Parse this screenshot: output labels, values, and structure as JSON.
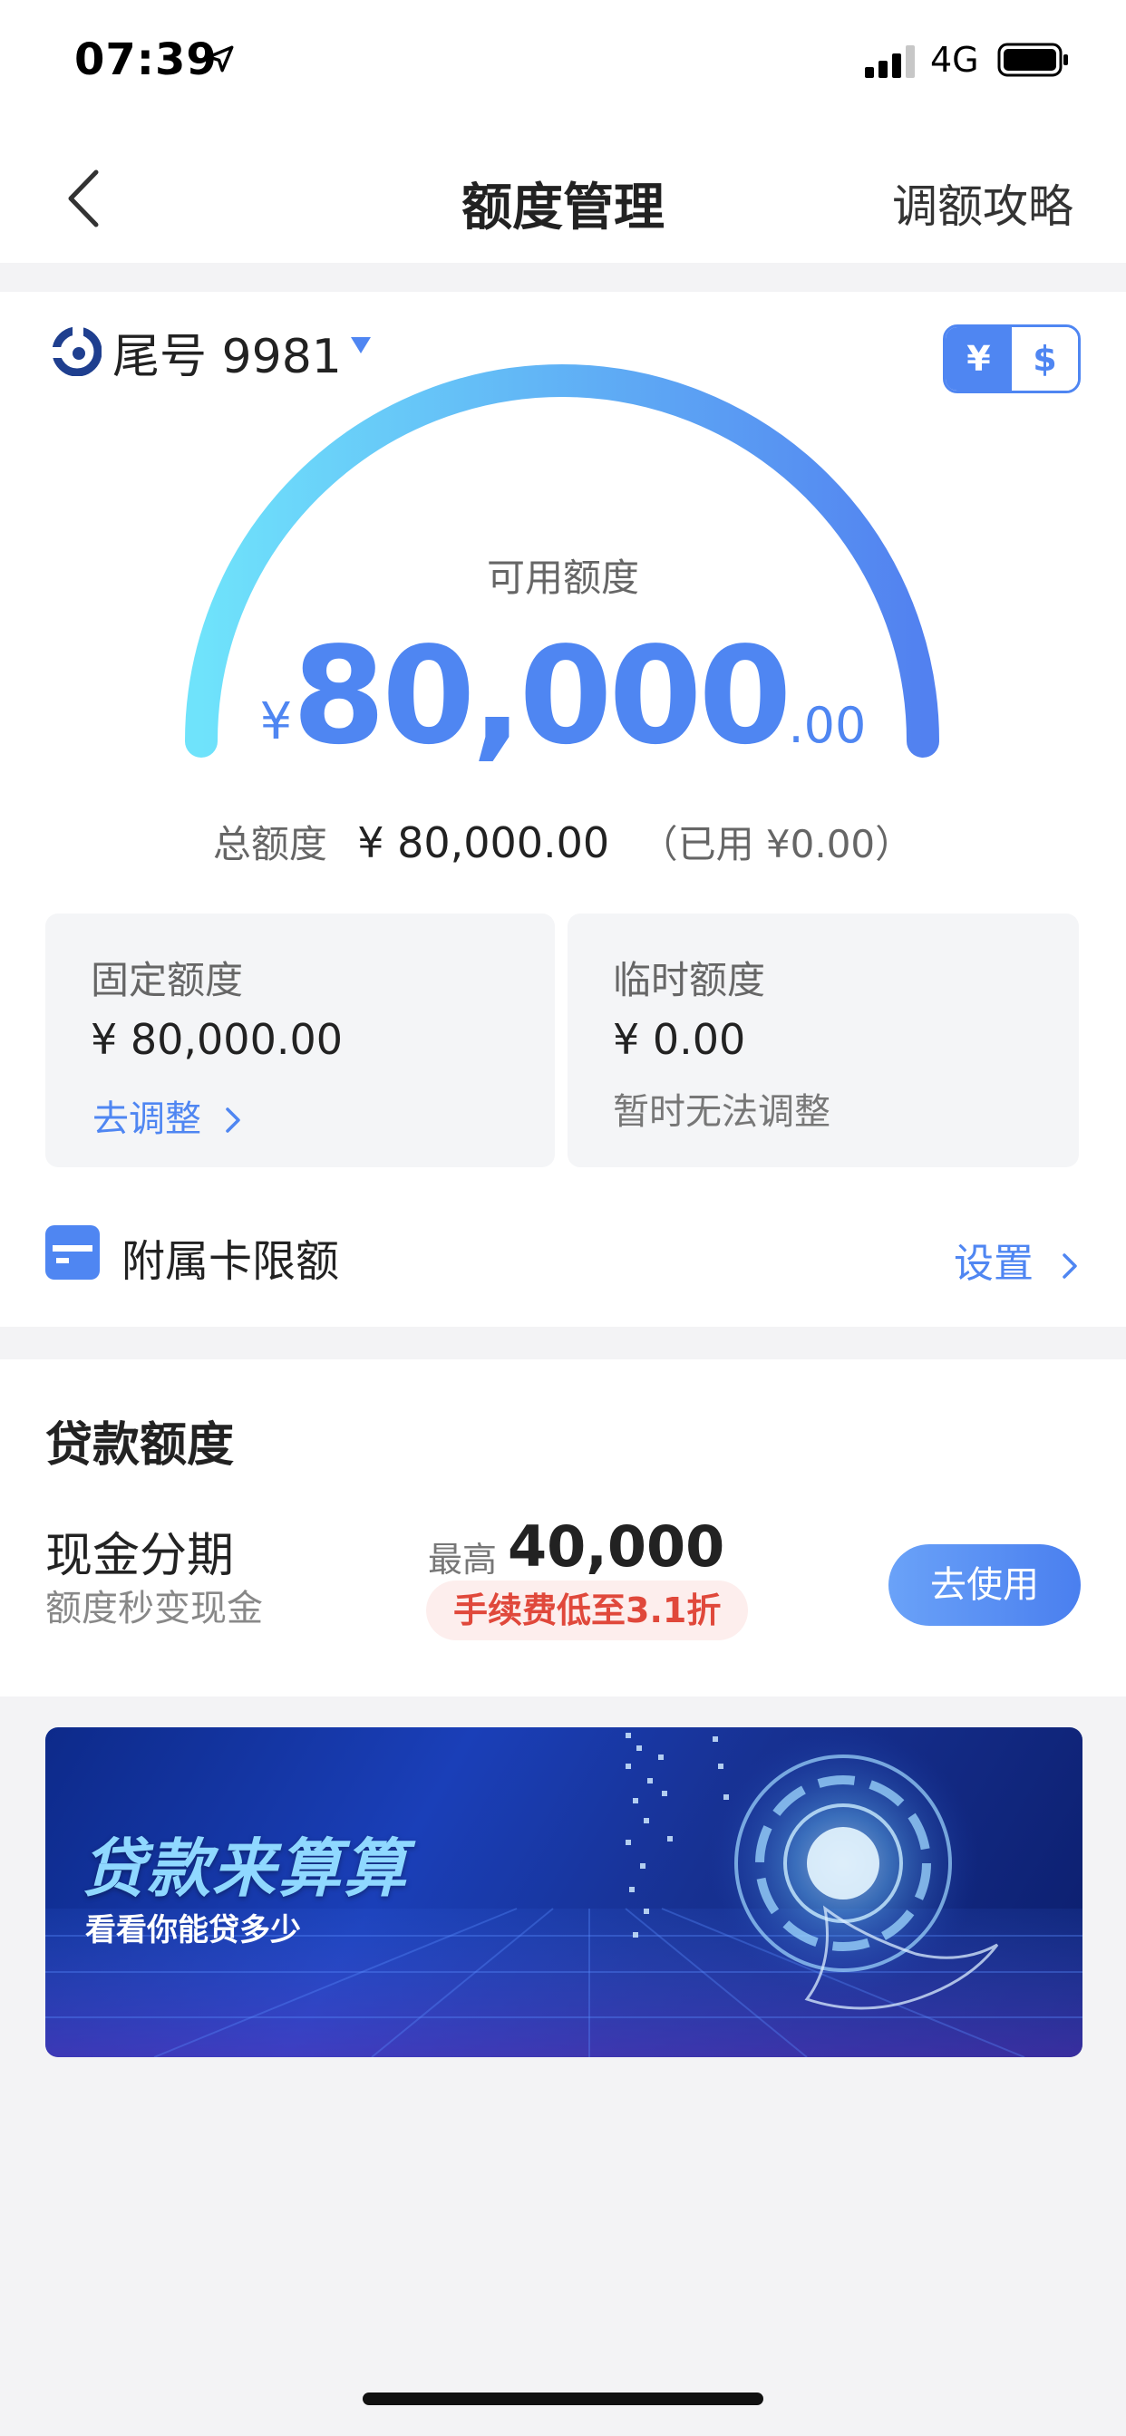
{
  "status_bar": {
    "time": "07:39",
    "network": "4G"
  },
  "nav": {
    "title": "额度管理",
    "right_action": "调额攻略"
  },
  "card": {
    "label": "尾号 9981",
    "currency_options": [
      "¥",
      "$"
    ],
    "selected_currency": "¥"
  },
  "available": {
    "label": "可用额度",
    "symbol": "¥",
    "integer": "80,000",
    "decimal": ".00"
  },
  "totals": {
    "label": "总额度",
    "value": "¥ 80,000.00",
    "used": "（已用 ¥0.00）"
  },
  "fixed_quota": {
    "title": "固定额度",
    "value": "¥ 80,000.00",
    "action": "去调整"
  },
  "temp_quota": {
    "title": "临时额度",
    "value": "¥ 0.00",
    "note": "暂时无法调整"
  },
  "sub_card": {
    "label": "附属卡限额",
    "action": "设置"
  },
  "loan": {
    "section_title": "贷款额度",
    "product_name": "现金分期",
    "product_desc": "额度秒变现金",
    "max_label": "最高",
    "max_value": "40,000",
    "fee_tag": "手续费低至3.1折",
    "button": "去使用"
  },
  "banner": {
    "title": "贷款来算算",
    "subtitle": "看看你能贷多少"
  },
  "colors": {
    "accent": "#4f86f2",
    "gauge_start": "#6fe0fb",
    "gauge_end": "#5282f0",
    "fee_red": "#e0483b"
  }
}
